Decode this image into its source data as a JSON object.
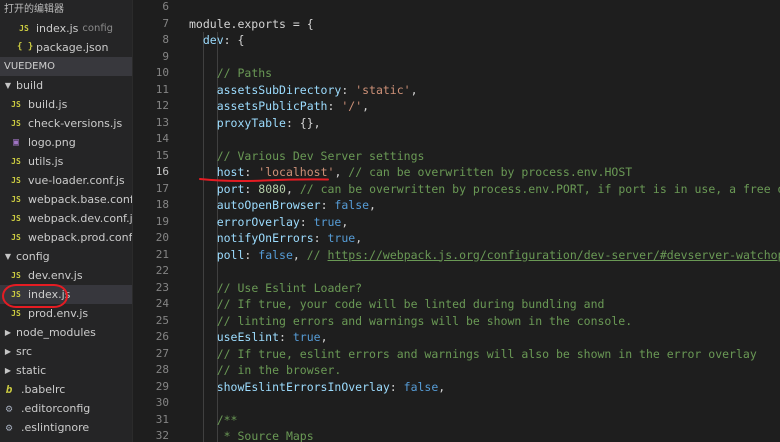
{
  "sidebar": {
    "open_editors_header": "打开的编辑器",
    "open_editors": [
      {
        "icon": "JS",
        "name": "index.js",
        "extra": "config"
      },
      {
        "icon": "{ }",
        "name": "package.json",
        "extra": ""
      }
    ],
    "project_header": "VUEDEMO",
    "tree": [
      {
        "type": "folder",
        "name": "build",
        "expanded": true,
        "depth": 0
      },
      {
        "type": "js",
        "icon": "JS",
        "name": "build.js",
        "depth": 1
      },
      {
        "type": "js",
        "icon": "JS",
        "name": "check-versions.js",
        "depth": 1
      },
      {
        "type": "png",
        "icon": "▣",
        "name": "logo.png",
        "depth": 1
      },
      {
        "type": "js",
        "icon": "JS",
        "name": "utils.js",
        "depth": 1
      },
      {
        "type": "js",
        "icon": "JS",
        "name": "vue-loader.conf.js",
        "depth": 1
      },
      {
        "type": "js",
        "icon": "JS",
        "name": "webpack.base.conf.js",
        "depth": 1
      },
      {
        "type": "js",
        "icon": "JS",
        "name": "webpack.dev.conf.js",
        "depth": 1
      },
      {
        "type": "js",
        "icon": "JS",
        "name": "webpack.prod.conf.js",
        "depth": 1
      },
      {
        "type": "folder",
        "name": "config",
        "expanded": true,
        "depth": 0
      },
      {
        "type": "js",
        "icon": "JS",
        "name": "dev.env.js",
        "depth": 1
      },
      {
        "type": "js",
        "icon": "JS",
        "name": "index.js",
        "depth": 1,
        "selected": true
      },
      {
        "type": "js",
        "icon": "JS",
        "name": "prod.env.js",
        "depth": 1
      },
      {
        "type": "folder",
        "name": "node_modules",
        "expanded": false,
        "depth": 0
      },
      {
        "type": "folder",
        "name": "src",
        "expanded": false,
        "depth": 0
      },
      {
        "type": "folder",
        "name": "static",
        "expanded": false,
        "depth": 0
      },
      {
        "type": "babel",
        "icon": "b",
        "name": ".babelrc",
        "depth": 0
      },
      {
        "type": "gear",
        "icon": "⚙",
        "name": ".editorconfig",
        "depth": 0
      },
      {
        "type": "gear",
        "icon": "⚙",
        "name": ".eslintignore",
        "depth": 0
      }
    ]
  },
  "editor": {
    "active_line": 16,
    "lines": [
      {
        "n": 6,
        "tokens": []
      },
      {
        "n": 7,
        "tokens": [
          [
            "p",
            "module.exports = {"
          ]
        ]
      },
      {
        "n": 8,
        "tokens": [
          [
            "p",
            "  "
          ],
          [
            "k",
            "dev"
          ],
          [
            "p",
            ": {"
          ]
        ]
      },
      {
        "n": 9,
        "tokens": []
      },
      {
        "n": 10,
        "tokens": [
          [
            "p",
            "    "
          ],
          [
            "c",
            "// Paths"
          ]
        ]
      },
      {
        "n": 11,
        "tokens": [
          [
            "p",
            "    "
          ],
          [
            "k",
            "assetsSubDirectory"
          ],
          [
            "p",
            ": "
          ],
          [
            "s",
            "'static'"
          ],
          [
            "p",
            ","
          ]
        ]
      },
      {
        "n": 12,
        "tokens": [
          [
            "p",
            "    "
          ],
          [
            "k",
            "assetsPublicPath"
          ],
          [
            "p",
            ": "
          ],
          [
            "s",
            "'/'"
          ],
          [
            "p",
            ","
          ]
        ]
      },
      {
        "n": 13,
        "tokens": [
          [
            "p",
            "    "
          ],
          [
            "k",
            "proxyTable"
          ],
          [
            "p",
            ": {},"
          ]
        ]
      },
      {
        "n": 14,
        "tokens": []
      },
      {
        "n": 15,
        "tokens": [
          [
            "p",
            "    "
          ],
          [
            "c",
            "// Various Dev Server settings"
          ]
        ]
      },
      {
        "n": 16,
        "tokens": [
          [
            "p",
            "    "
          ],
          [
            "k",
            "host"
          ],
          [
            "p",
            ": "
          ],
          [
            "s",
            "'localhost'"
          ],
          [
            "p",
            ", "
          ],
          [
            "c",
            "// can be overwritten by process.env.HOST"
          ]
        ]
      },
      {
        "n": 17,
        "tokens": [
          [
            "p",
            "    "
          ],
          [
            "k",
            "port"
          ],
          [
            "p",
            ": "
          ],
          [
            "n",
            "8080"
          ],
          [
            "p",
            ", "
          ],
          [
            "c",
            "// can be overwritten by process.env.PORT, if port is in use, a free one will be determined"
          ]
        ]
      },
      {
        "n": 18,
        "tokens": [
          [
            "p",
            "    "
          ],
          [
            "k",
            "autoOpenBrowser"
          ],
          [
            "p",
            ": "
          ],
          [
            "kw",
            "false"
          ],
          [
            "p",
            ","
          ]
        ]
      },
      {
        "n": 19,
        "tokens": [
          [
            "p",
            "    "
          ],
          [
            "k",
            "errorOverlay"
          ],
          [
            "p",
            ": "
          ],
          [
            "kw",
            "true"
          ],
          [
            "p",
            ","
          ]
        ]
      },
      {
        "n": 20,
        "tokens": [
          [
            "p",
            "    "
          ],
          [
            "k",
            "notifyOnErrors"
          ],
          [
            "p",
            ": "
          ],
          [
            "kw",
            "true"
          ],
          [
            "p",
            ","
          ]
        ]
      },
      {
        "n": 21,
        "tokens": [
          [
            "p",
            "    "
          ],
          [
            "k",
            "poll"
          ],
          [
            "p",
            ": "
          ],
          [
            "kw",
            "false"
          ],
          [
            "p",
            ", "
          ],
          [
            "c",
            "// "
          ],
          [
            "u",
            "https://webpack.js.org/configuration/dev-server/#devserver-watchoptions-"
          ]
        ]
      },
      {
        "n": 22,
        "tokens": []
      },
      {
        "n": 23,
        "tokens": [
          [
            "p",
            "    "
          ],
          [
            "c",
            "// Use Eslint Loader?"
          ]
        ]
      },
      {
        "n": 24,
        "tokens": [
          [
            "p",
            "    "
          ],
          [
            "c",
            "// If true, your code will be linted during bundling and"
          ]
        ]
      },
      {
        "n": 25,
        "tokens": [
          [
            "p",
            "    "
          ],
          [
            "c",
            "// linting errors and warnings will be shown in the console."
          ]
        ]
      },
      {
        "n": 26,
        "tokens": [
          [
            "p",
            "    "
          ],
          [
            "k",
            "useEslint"
          ],
          [
            "p",
            ": "
          ],
          [
            "kw",
            "true"
          ],
          [
            "p",
            ","
          ]
        ]
      },
      {
        "n": 27,
        "tokens": [
          [
            "p",
            "    "
          ],
          [
            "c",
            "// If true, eslint errors and warnings will also be shown in the error overlay"
          ]
        ]
      },
      {
        "n": 28,
        "tokens": [
          [
            "p",
            "    "
          ],
          [
            "c",
            "// in the browser."
          ]
        ]
      },
      {
        "n": 29,
        "tokens": [
          [
            "p",
            "    "
          ],
          [
            "k",
            "showEslintErrorsInOverlay"
          ],
          [
            "p",
            ": "
          ],
          [
            "kw",
            "false"
          ],
          [
            "p",
            ","
          ]
        ]
      },
      {
        "n": 30,
        "tokens": []
      },
      {
        "n": 31,
        "tokens": [
          [
            "p",
            "    "
          ],
          [
            "c",
            "/**"
          ]
        ]
      },
      {
        "n": 32,
        "tokens": [
          [
            "p",
            "    "
          ],
          [
            "c",
            " * Source Maps"
          ]
        ]
      }
    ]
  },
  "colors": {
    "annotation": "#e51c23",
    "sidebar_bg": "#252526",
    "editor_bg": "#1e1e1e"
  }
}
